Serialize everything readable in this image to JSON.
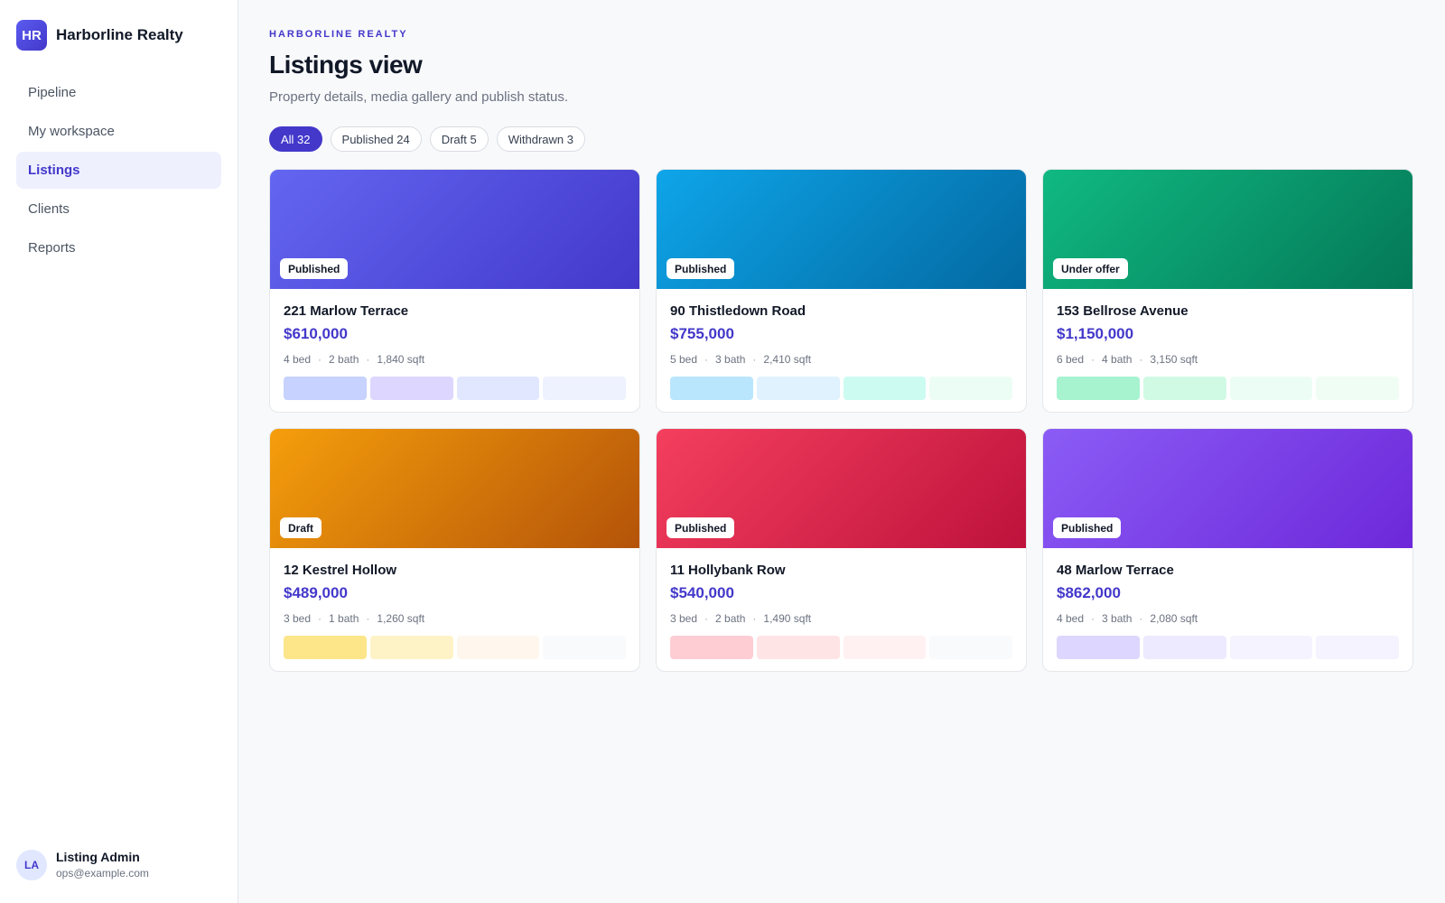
{
  "brand": {
    "logo": "HR",
    "name": "Harborline Realty"
  },
  "nav": [
    {
      "label": "Pipeline",
      "active": false
    },
    {
      "label": "My workspace",
      "active": false
    },
    {
      "label": "Listings",
      "active": true
    },
    {
      "label": "Clients",
      "active": false
    },
    {
      "label": "Reports",
      "active": false
    }
  ],
  "user": {
    "initials": "LA",
    "name": "Listing Admin",
    "email": "ops@example.com"
  },
  "header": {
    "eyebrow": "HARBORLINE REALTY",
    "title": "Listings view",
    "subtitle": "Property details, media gallery and publish status."
  },
  "filters": [
    {
      "label": "All 32",
      "active": true
    },
    {
      "label": "Published 24",
      "active": false
    },
    {
      "label": "Draft 5",
      "active": false
    },
    {
      "label": "Withdrawn 3",
      "active": false
    }
  ],
  "listings": [
    {
      "status": "Published",
      "title": "221 Marlow Terrace",
      "price": "$610,000",
      "beds": "4 bed",
      "baths": "2 bath",
      "sqft": "1,840 sqft",
      "cover": [
        "#6366f1",
        "#4338ca"
      ],
      "thumbs": [
        "#c7d2fe",
        "#ddd6fe",
        "#e0e7ff",
        "#eef2ff"
      ]
    },
    {
      "status": "Published",
      "title": "90 Thistledown Road",
      "price": "$755,000",
      "beds": "5 bed",
      "baths": "3 bath",
      "sqft": "2,410 sqft",
      "cover": [
        "#0ea5e9",
        "#0369a1"
      ],
      "thumbs": [
        "#bae6fd",
        "#e0f2fe",
        "#ccfbf1",
        "#ecfdf5"
      ]
    },
    {
      "status": "Under offer",
      "title": "153 Bellrose Avenue",
      "price": "$1,150,000",
      "beds": "6 bed",
      "baths": "4 bath",
      "sqft": "3,150 sqft",
      "cover": [
        "#10b981",
        "#047857"
      ],
      "thumbs": [
        "#a7f3d0",
        "#d1fae5",
        "#ecfdf5",
        "#f0fdf4"
      ]
    },
    {
      "status": "Draft",
      "title": "12 Kestrel Hollow",
      "price": "$489,000",
      "beds": "3 bed",
      "baths": "1 bath",
      "sqft": "1,260 sqft",
      "cover": [
        "#f59e0b",
        "#b45309"
      ],
      "thumbs": [
        "#fde68a",
        "#fef3c7",
        "#fff7ed",
        "#f9fafb"
      ]
    },
    {
      "status": "Published",
      "title": "11 Hollybank Row",
      "price": "$540,000",
      "beds": "3 bed",
      "baths": "2 bath",
      "sqft": "1,490 sqft",
      "cover": [
        "#f43f5e",
        "#be123c"
      ],
      "thumbs": [
        "#fecdd3",
        "#ffe4e6",
        "#fff1f2",
        "#f9fafb"
      ]
    },
    {
      "status": "Published",
      "title": "48 Marlow Terrace",
      "price": "$862,000",
      "beds": "4 bed",
      "baths": "3 bath",
      "sqft": "2,080 sqft",
      "cover": [
        "#8b5cf6",
        "#6d28d9"
      ],
      "thumbs": [
        "#ddd6fe",
        "#ede9fe",
        "#f5f3ff",
        "#f5f3ff"
      ]
    }
  ],
  "colors": {
    "accent": "#4338ca",
    "accent_soft": "#eef0fd"
  }
}
